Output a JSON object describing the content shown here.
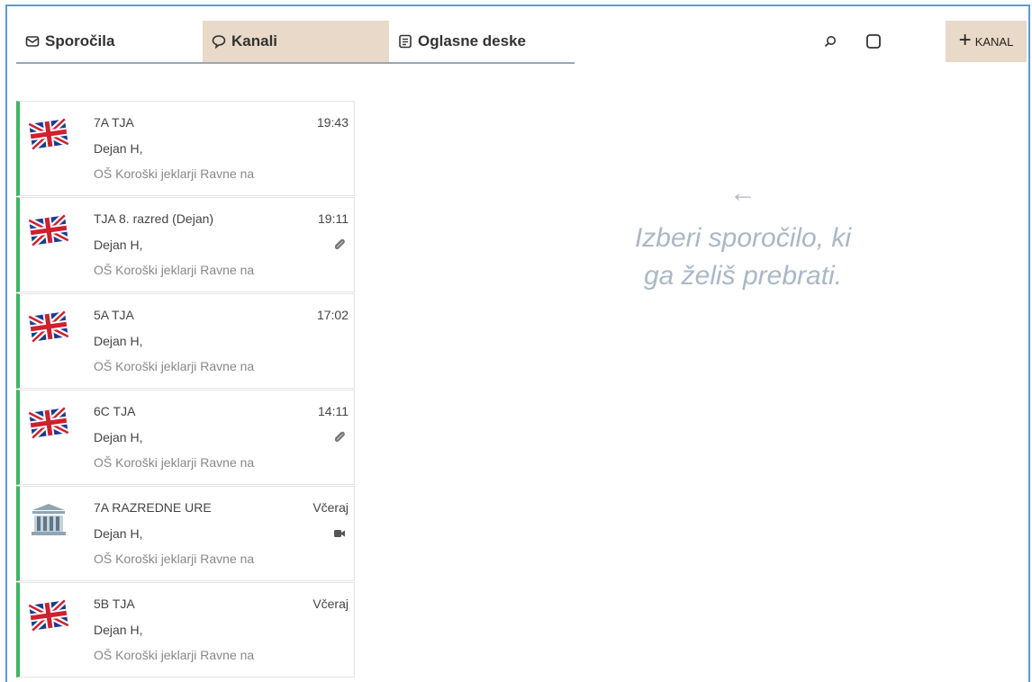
{
  "tabs": [
    {
      "label": "Sporočila",
      "icon": "mail-icon",
      "active": false
    },
    {
      "label": "Kanali",
      "icon": "chat-bubble-icon",
      "active": true
    },
    {
      "label": "Oglasne deske",
      "icon": "board-icon",
      "active": false
    }
  ],
  "toolbar": {
    "add_channel_label": "KANAL",
    "add_channel_icon": "plus-icon",
    "search_icon": "search-icon",
    "select_icon": "square-icon"
  },
  "channels": [
    {
      "title": "7A TJA",
      "sender": "Dejan H,",
      "school": "OŠ Koroški jeklarji Ravne na",
      "time": "19:43",
      "badge": "",
      "avatar": "uk-flag-icon"
    },
    {
      "title": "TJA 8. razred (Dejan)",
      "sender": "Dejan H,",
      "school": "OŠ Koroški jeklarji Ravne na",
      "time": "19:11",
      "badge": "paperclip-icon",
      "avatar": "uk-flag-icon"
    },
    {
      "title": "5A TJA",
      "sender": "Dejan H,",
      "school": "OŠ Koroški jeklarji Ravne na",
      "time": "17:02",
      "badge": "",
      "avatar": "uk-flag-icon"
    },
    {
      "title": "6C TJA",
      "sender": "Dejan H,",
      "school": "OŠ Koroški jeklarji Ravne na",
      "time": "14:11",
      "badge": "paperclip-icon",
      "avatar": "uk-flag-icon"
    },
    {
      "title": "7A RAZREDNE URE",
      "sender": "Dejan H,",
      "school": "OŠ Koroški jeklarji Ravne na",
      "time": "Včeraj",
      "badge": "video-camera-icon",
      "avatar": "school-building-icon"
    },
    {
      "title": "5B TJA",
      "sender": "Dejan H,",
      "school": "OŠ Koroški jeklarji Ravne na",
      "time": "Včeraj",
      "badge": "",
      "avatar": "uk-flag-icon"
    }
  ],
  "empty_state": {
    "line1": "Izberi sporočilo, ki",
    "line2": "ga želiš prebrati.",
    "arrow_icon": "arrow-left-icon"
  },
  "colors": {
    "active_tab": "#e8d9c8",
    "unread_bar": "#3cb763",
    "empty_text": "#aab8c6"
  }
}
